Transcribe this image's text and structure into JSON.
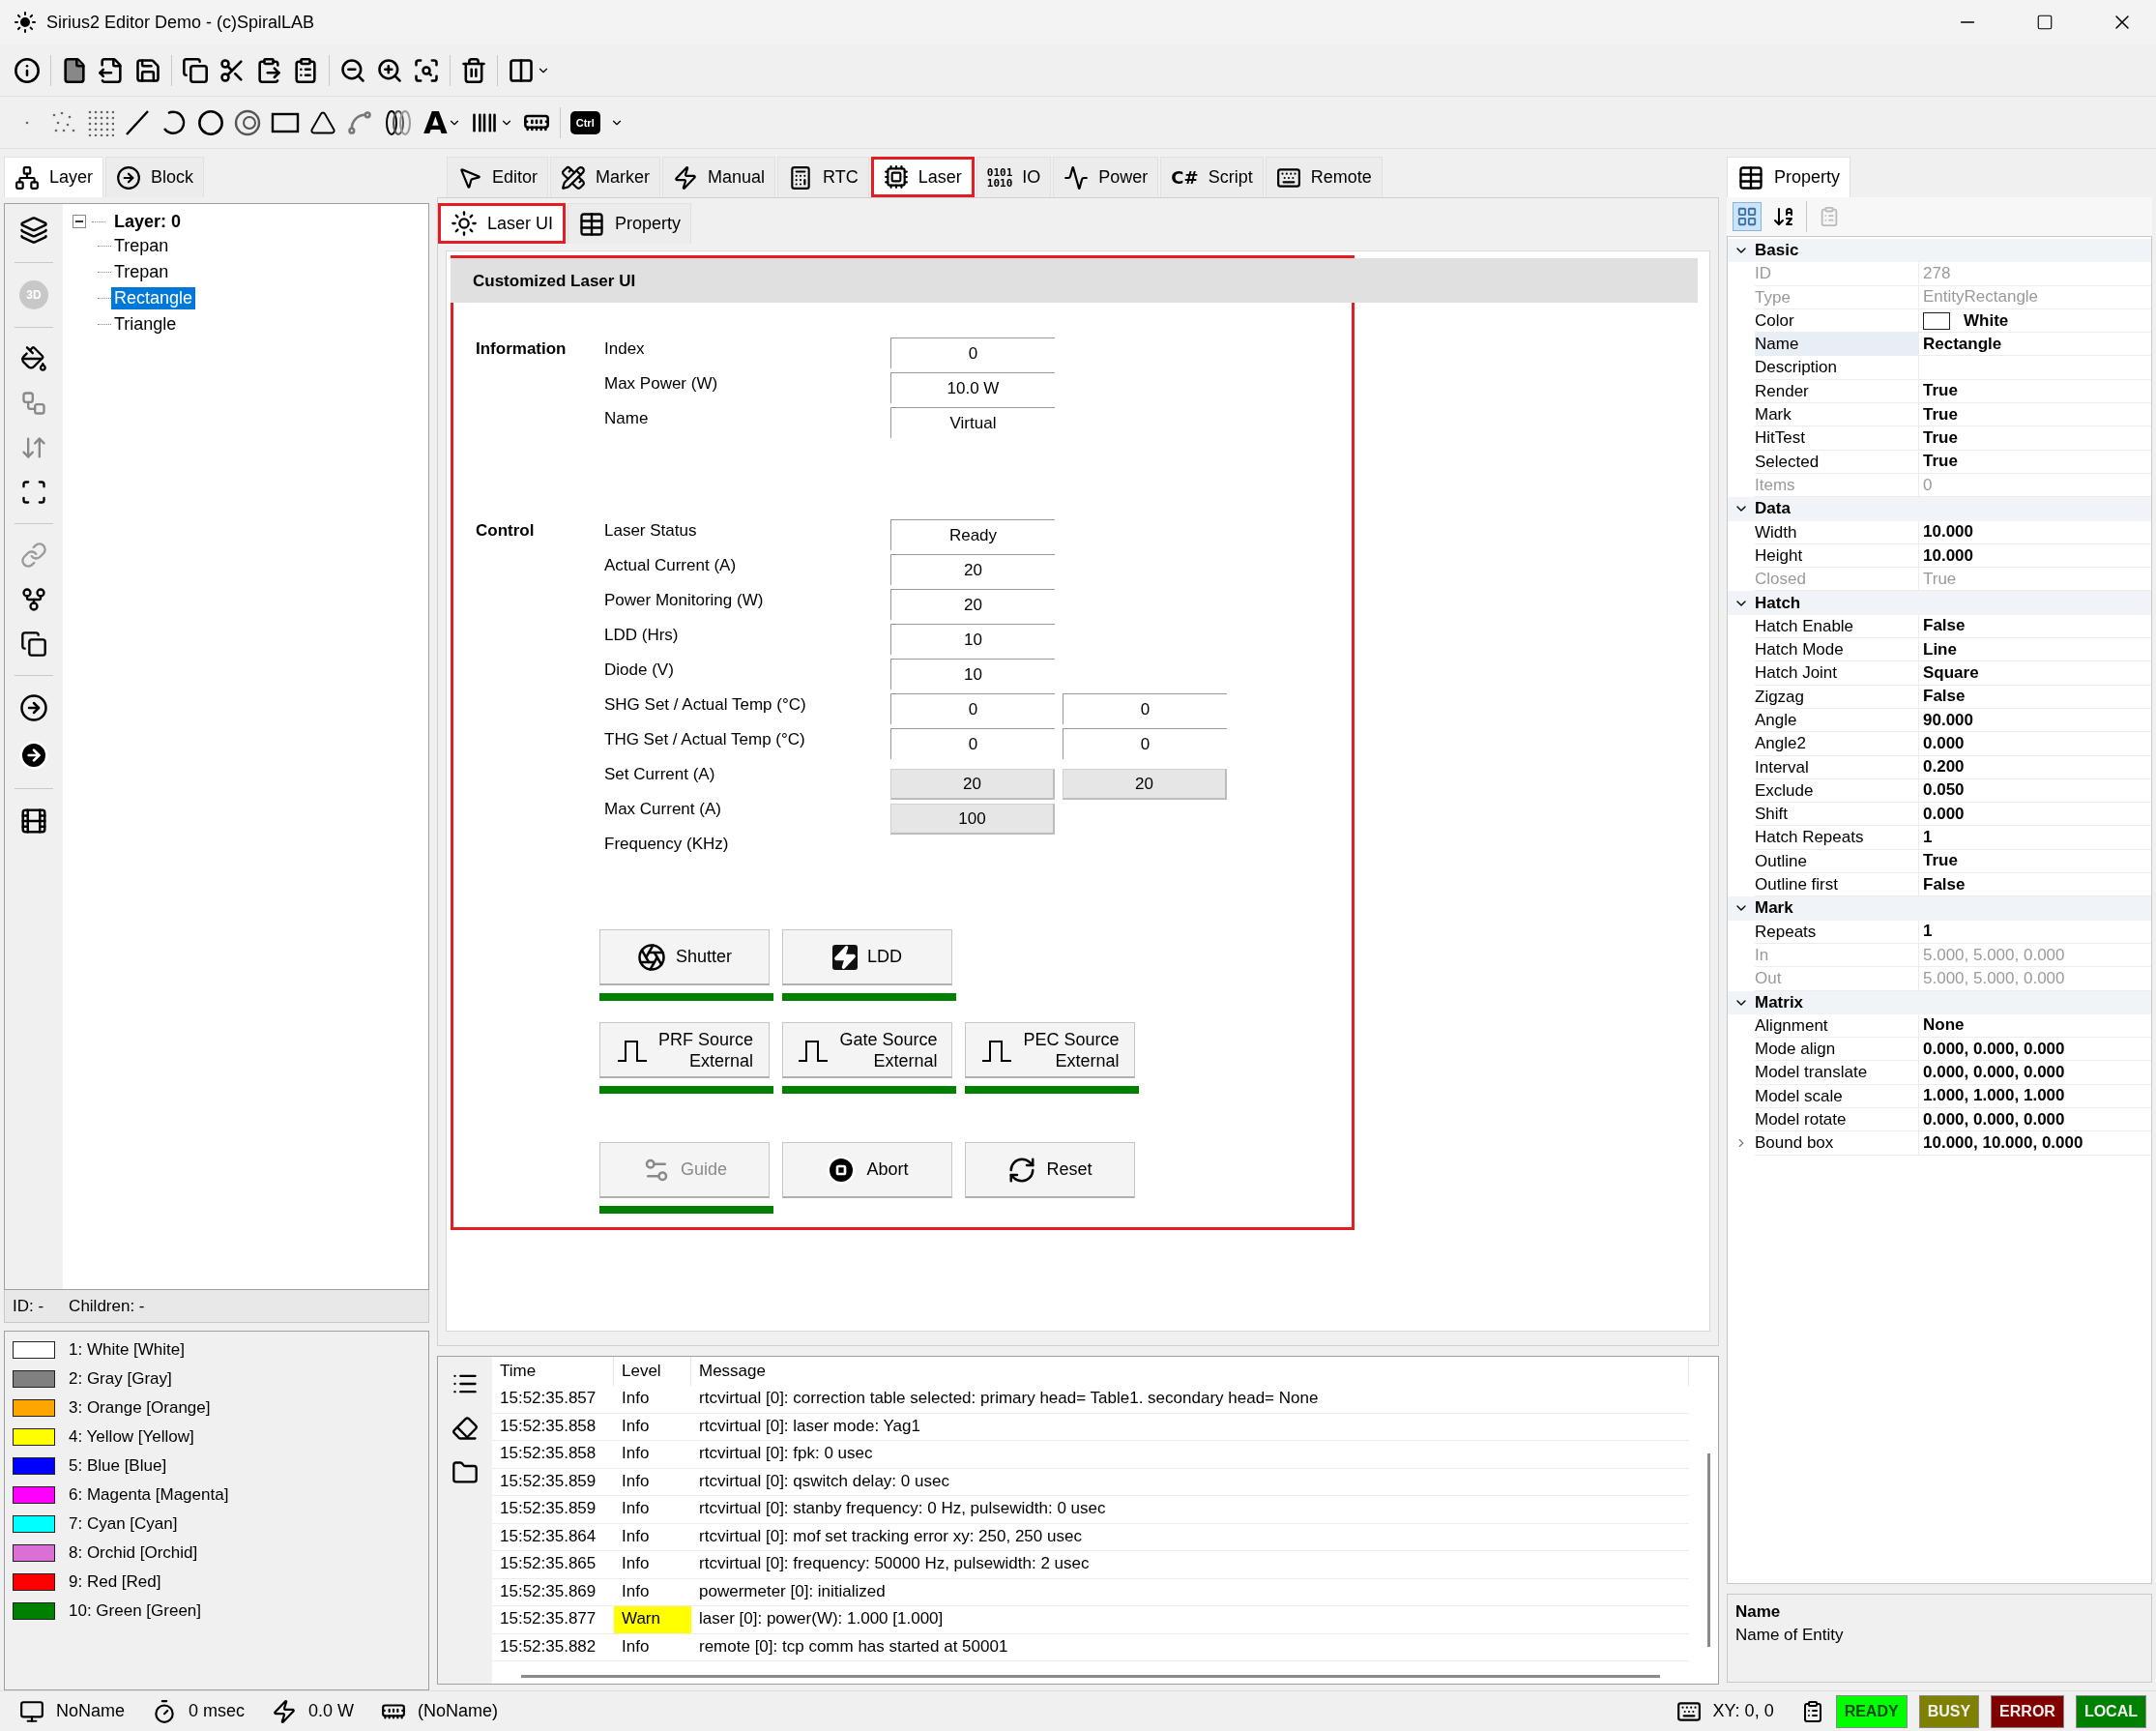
{
  "window": {
    "title": "Sirius2 Editor Demo - (c)SpiralLAB"
  },
  "toolbar": {
    "text_tool_label": "A",
    "ctrl_label": "Ctrl"
  },
  "left_panel": {
    "tabs": [
      {
        "label": "Layer",
        "selected": true
      },
      {
        "label": "Block",
        "selected": false
      }
    ],
    "tools": {
      "3d_label": "3D"
    },
    "tree": [
      {
        "label": "Layer: 0",
        "expanded": true,
        "selected": false,
        "children": [
          {
            "label": "Trepan",
            "selected": false
          },
          {
            "label": "Trepan",
            "selected": false
          },
          {
            "label": "Rectangle",
            "selected": true
          },
          {
            "label": "Triangle",
            "selected": false
          }
        ]
      }
    ],
    "info": {
      "id": "ID: -",
      "children": "Children: -"
    },
    "pens": [
      {
        "label": "1: White [White]",
        "color": "#ffffff"
      },
      {
        "label": "2: Gray [Gray]",
        "color": "#808080"
      },
      {
        "label": "3: Orange [Orange]",
        "color": "#ffa500"
      },
      {
        "label": "4: Yellow [Yellow]",
        "color": "#ffff00"
      },
      {
        "label": "5: Blue [Blue]",
        "color": "#0000ff"
      },
      {
        "label": "6: Magenta [Magenta]",
        "color": "#ff00ff"
      },
      {
        "label": "7: Cyan [Cyan]",
        "color": "#00ffff"
      },
      {
        "label": "8: Orchid [Orchid]",
        "color": "#da70d6"
      },
      {
        "label": "9: Red [Red]",
        "color": "#ff0000"
      },
      {
        "label": "10: Green [Green]",
        "color": "#008000"
      }
    ]
  },
  "main_tabs": [
    {
      "label": "Editor",
      "selected": false,
      "highlighted": false
    },
    {
      "label": "Marker",
      "selected": false,
      "highlighted": false
    },
    {
      "label": "Manual",
      "selected": false,
      "highlighted": false
    },
    {
      "label": "RTC",
      "selected": false,
      "highlighted": false
    },
    {
      "label": "Laser",
      "selected": true,
      "highlighted": true
    },
    {
      "label": "IO",
      "icon_text": "0101 1010",
      "selected": false,
      "highlighted": false
    },
    {
      "label": "Power",
      "selected": false,
      "highlighted": false
    },
    {
      "label": "Script",
      "icon_text": "C#",
      "selected": false,
      "highlighted": false
    },
    {
      "label": "Remote",
      "selected": false,
      "highlighted": false
    }
  ],
  "sub_tabs": [
    {
      "label": "Laser UI",
      "selected": true,
      "highlighted": true
    },
    {
      "label": "Property",
      "selected": false,
      "highlighted": false
    }
  ],
  "laser_ui": {
    "title": "Customized Laser UI",
    "highlighted": true,
    "sections": [
      {
        "heading": "Information",
        "rows": [
          {
            "label": "Index",
            "kind": "readout",
            "values": [
              "0"
            ]
          },
          {
            "label": "Max Power (W)",
            "kind": "readout",
            "values": [
              "10.0 W"
            ]
          },
          {
            "label": "Name",
            "kind": "readout",
            "values": [
              "Virtual"
            ]
          }
        ]
      },
      {
        "heading": "Control",
        "rows": [
          {
            "label": "Laser Status",
            "kind": "readout",
            "values": [
              "Ready"
            ]
          },
          {
            "label": "Actual Current (A)",
            "kind": "readout",
            "values": [
              "20"
            ]
          },
          {
            "label": "Power Monitoring (W)",
            "kind": "readout",
            "values": [
              "20"
            ]
          },
          {
            "label": "LDD (Hrs)",
            "kind": "readout",
            "values": [
              "10"
            ]
          },
          {
            "label": "Diode (V)",
            "kind": "readout",
            "values": [
              "10"
            ]
          },
          {
            "label": "SHG Set / Actual Temp (°C)",
            "kind": "readout",
            "values": [
              "0",
              "0"
            ]
          },
          {
            "label": "THG Set / Actual Temp (°C)",
            "kind": "readout",
            "values": [
              "0",
              "0"
            ]
          },
          {
            "label": "Set Current (A)",
            "kind": "setpoint",
            "values": [
              "20",
              "20"
            ]
          },
          {
            "label": "Max Current (A)",
            "kind": "setpoint",
            "values": [
              "100"
            ]
          },
          {
            "label": "Frequency (KHz)"
          }
        ]
      }
    ],
    "button_rows": [
      [
        {
          "label": "Shutter",
          "kind": "shutter",
          "on": true,
          "disabled": false
        },
        {
          "label": "LDD",
          "kind": "ldd",
          "on": true,
          "disabled": false
        }
      ],
      [
        {
          "label": "PRF Source",
          "sublabel": "External",
          "kind": "source",
          "on": true,
          "disabled": false
        },
        {
          "label": "Gate Source",
          "sublabel": "External",
          "kind": "source",
          "on": true,
          "disabled": false
        },
        {
          "label": "PEC Source",
          "sublabel": "External",
          "kind": "source",
          "on": true,
          "disabled": false
        }
      ],
      [
        {
          "label": "Guide",
          "kind": "guide",
          "on": true,
          "disabled": true
        },
        {
          "label": "Abort",
          "kind": "abort",
          "on": false,
          "disabled": false
        },
        {
          "label": "Reset",
          "kind": "reset",
          "on": false,
          "disabled": false
        }
      ]
    ]
  },
  "log": {
    "columns": [
      "Time",
      "Level",
      "Message"
    ],
    "rows": [
      {
        "time": "15:52:35.857",
        "level": "Info",
        "warning": false,
        "message": "rtcvirtual [0]: correction table selected: primary head= Table1. secondary head= None"
      },
      {
        "time": "15:52:35.858",
        "level": "Info",
        "warning": false,
        "message": "rtcvirtual [0]: laser mode: Yag1"
      },
      {
        "time": "15:52:35.858",
        "level": "Info",
        "warning": false,
        "message": "rtcvirtual [0]: fpk: 0 usec"
      },
      {
        "time": "15:52:35.859",
        "level": "Info",
        "warning": false,
        "message": "rtcvirtual [0]: qswitch delay: 0 usec"
      },
      {
        "time": "15:52:35.859",
        "level": "Info",
        "warning": false,
        "message": "rtcvirtual [0]: stanby frequency: 0 Hz, pulsewidth: 0 usec"
      },
      {
        "time": "15:52:35.864",
        "level": "Info",
        "warning": false,
        "message": "rtcvirtual [0]: mof set tracking error xy: 250, 250 usec"
      },
      {
        "time": "15:52:35.865",
        "level": "Info",
        "warning": false,
        "message": "rtcvirtual [0]: frequency: 50000 Hz, pulsewidth: 2 usec"
      },
      {
        "time": "15:52:35.869",
        "level": "Info",
        "warning": false,
        "message": "powermeter [0]: initialized"
      },
      {
        "time": "15:52:35.877",
        "level": "Warn",
        "warning": true,
        "message": "laser [0]: power(W): 1.000 [1.000]"
      },
      {
        "time": "15:52:35.882",
        "level": "Info",
        "warning": false,
        "message": "remote [0]: tcp comm has started at 50001"
      }
    ]
  },
  "property_panel": {
    "tab": {
      "label": "Property",
      "selected": true
    },
    "sections": [
      {
        "name": "Basic",
        "expanded": true,
        "rows": [
          {
            "name": "ID",
            "value": "278",
            "kind": "plain",
            "readonly": true,
            "selected": false
          },
          {
            "name": "Type",
            "value": "EntityRectangle",
            "kind": "plain",
            "readonly": true,
            "selected": false
          },
          {
            "name": "Color",
            "value": "White",
            "kind": "color",
            "color": "#ffffff",
            "readonly": false,
            "selected": false
          },
          {
            "name": "Name",
            "value": "Rectangle",
            "kind": "plain",
            "readonly": false,
            "selected": true
          },
          {
            "name": "Description",
            "kind": "plain",
            "readonly": false,
            "selected": false
          },
          {
            "name": "Render",
            "value": "True",
            "kind": "plain",
            "readonly": false,
            "selected": false
          },
          {
            "name": "Mark",
            "value": "True",
            "kind": "plain",
            "readonly": false,
            "selected": false
          },
          {
            "name": "HitTest",
            "value": "True",
            "kind": "plain",
            "readonly": false,
            "selected": false
          },
          {
            "name": "Selected",
            "value": "True",
            "kind": "plain",
            "readonly": false,
            "selected": false
          },
          {
            "name": "Items",
            "value": "0",
            "kind": "plain",
            "readonly": true,
            "selected": false
          }
        ]
      },
      {
        "name": "Data",
        "expanded": true,
        "rows": [
          {
            "name": "Width",
            "value": "10.000",
            "kind": "plain",
            "readonly": false,
            "selected": false
          },
          {
            "name": "Height",
            "value": "10.000",
            "kind": "plain",
            "readonly": false,
            "selected": false
          },
          {
            "name": "Closed",
            "value": "True",
            "kind": "plain",
            "readonly": true,
            "selected": false
          }
        ]
      },
      {
        "name": "Hatch",
        "expanded": true,
        "rows": [
          {
            "name": "Hatch Enable",
            "value": "False",
            "kind": "plain",
            "readonly": false,
            "selected": false
          },
          {
            "name": "Hatch Mode",
            "value": "Line",
            "kind": "plain",
            "readonly": false,
            "selected": false
          },
          {
            "name": "Hatch Joint",
            "value": "Square",
            "kind": "plain",
            "readonly": false,
            "selected": false
          },
          {
            "name": "Zigzag",
            "value": "False",
            "kind": "plain",
            "readonly": false,
            "selected": false
          },
          {
            "name": "Angle",
            "value": "90.000",
            "kind": "plain",
            "readonly": false,
            "selected": false
          },
          {
            "name": "Angle2",
            "value": "0.000",
            "kind": "plain",
            "readonly": false,
            "selected": false
          },
          {
            "name": "Interval",
            "value": "0.200",
            "kind": "plain",
            "readonly": false,
            "selected": false
          },
          {
            "name": "Exclude",
            "value": "0.050",
            "kind": "plain",
            "readonly": false,
            "selected": false
          },
          {
            "name": "Shift",
            "value": "0.000",
            "kind": "plain",
            "readonly": false,
            "selected": false
          },
          {
            "name": "Hatch Repeats",
            "value": "1",
            "kind": "plain",
            "readonly": false,
            "selected": false
          },
          {
            "name": "Outline",
            "value": "True",
            "kind": "plain",
            "readonly": false,
            "selected": false
          },
          {
            "name": "Outline first",
            "value": "False",
            "kind": "plain",
            "readonly": false,
            "selected": false
          }
        ]
      },
      {
        "name": "Mark",
        "expanded": true,
        "rows": [
          {
            "name": "Repeats",
            "value": "1",
            "kind": "plain",
            "readonly": false,
            "selected": false
          },
          {
            "name": "In",
            "value": "5.000, 5.000, 0.000",
            "kind": "plain",
            "readonly": true,
            "selected": false
          },
          {
            "name": "Out",
            "value": "5.000, 5.000, 0.000",
            "kind": "plain",
            "readonly": true,
            "selected": false
          }
        ]
      },
      {
        "name": "Matrix",
        "expanded": true,
        "rows": [
          {
            "name": "Alignment",
            "value": "None",
            "kind": "plain",
            "readonly": false,
            "selected": false
          },
          {
            "name": "Mode align",
            "value": "0.000, 0.000, 0.000",
            "kind": "plain",
            "readonly": false,
            "selected": false
          },
          {
            "name": "Model translate",
            "value": "0.000, 0.000, 0.000",
            "kind": "plain",
            "readonly": false,
            "selected": false
          },
          {
            "name": "Model scale",
            "value": "1.000, 1.000, 1.000",
            "kind": "plain",
            "readonly": false,
            "selected": false
          },
          {
            "name": "Model rotate",
            "value": "0.000, 0.000, 0.000",
            "kind": "plain",
            "readonly": false,
            "selected": false
          },
          {
            "name": "Bound box",
            "value": "10.000, 10.000, 0.000",
            "kind": "group",
            "readonly": false,
            "selected": false
          }
        ]
      }
    ],
    "description": {
      "title": "Name",
      "text": "Name of Entity"
    }
  },
  "status_bar": {
    "items": [
      "NoName",
      "0 msec",
      "0.0 W",
      "(NoName)"
    ],
    "coordinates": "XY: 0, 0",
    "badges": [
      {
        "label": "READY",
        "color": "#00ff00"
      },
      {
        "label": "BUSY",
        "color": "#808000"
      },
      {
        "label": "ERROR",
        "color": "#800000"
      },
      {
        "label": "LOCAL",
        "color": "#008000"
      }
    ]
  }
}
